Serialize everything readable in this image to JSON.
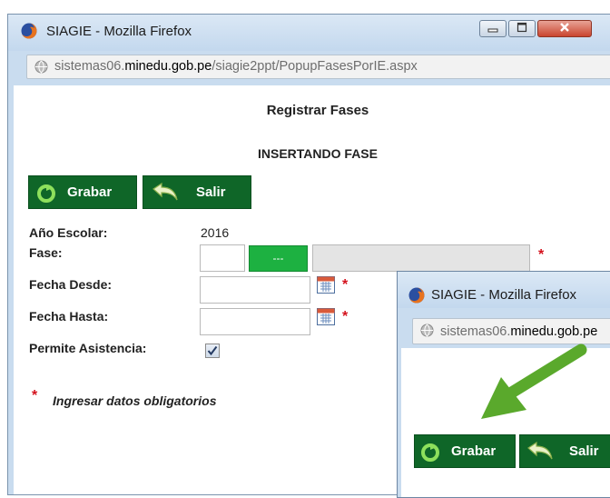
{
  "main_window": {
    "title": "SIAGIE - Mozilla Firefox",
    "url_prefix": "sistemas06.",
    "url_host": "minedu.gob.pe",
    "url_path": "/siagie2ppt/PopupFasesPorIE.aspx",
    "heading": "Registrar Fases",
    "subheading": "INSERTANDO FASE",
    "grabar_label": "Grabar",
    "salir_label": "Salir",
    "form": {
      "anio_label": "Año Escolar:",
      "anio_value": "2016",
      "fase_label": "Fase:",
      "fase_button": "---",
      "desde_label": "Fecha Desde:",
      "hasta_label": "Fecha Hasta:",
      "asistencia_label": "Permite Asistencia:",
      "asistencia_checked": true
    },
    "required_marker": "*",
    "required_note": "Ingresar datos obligatorios"
  },
  "zoom_window": {
    "title": "SIAGIE - Mozilla Firefox",
    "url_prefix": "sistemas06.",
    "url_host": "minedu.gob.pe",
    "grabar_label": "Grabar",
    "salir_label": "Salir"
  },
  "colors": {
    "button_green": "#0f6628",
    "accent_green": "#1db141",
    "arrow_green": "#5aa92c",
    "required_red": "#d4111c"
  }
}
